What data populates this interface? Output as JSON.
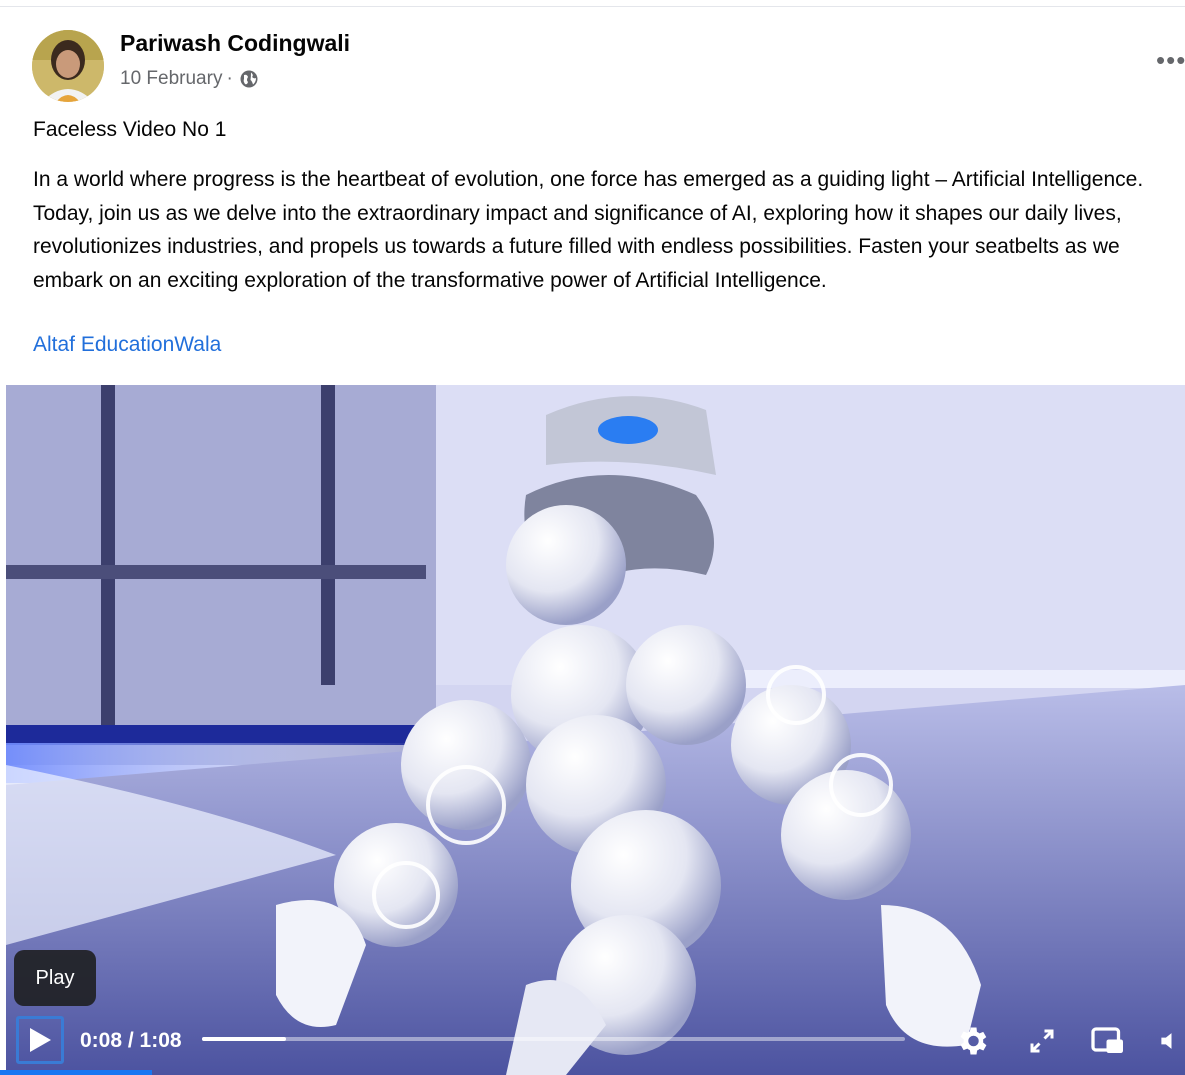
{
  "post": {
    "author": "Pariwash Codingwali",
    "date": "10 February",
    "separator": "·",
    "more_label": "•••",
    "title": "Faceless Video No 1",
    "description": "In a world where progress is the heartbeat of evolution, one force has emerged as a guiding light – Artificial Intelligence. Today, join us as we delve into the extraordinary impact and significance of AI, exploring how it shapes our daily lives, revolutionizes industries, and propels us towards a future filled with endless possibilities. Fasten your seatbelts as we embark on an exciting exploration of the transformative power of Artificial Intelligence.",
    "tag": "Altaf EducationWala"
  },
  "video": {
    "tooltip": "Play",
    "time": "0:08 / 1:08",
    "progress_fraction": 0.12
  },
  "icons": {
    "globe": "globe-icon",
    "play": "play-icon",
    "settings": "gear-icon",
    "fullscreen": "expand-icon",
    "pip": "picture-in-picture-icon",
    "volume": "volume-icon"
  },
  "colors": {
    "link": "#216fdb",
    "meta": "#65676b",
    "accent": "#1877f2"
  }
}
